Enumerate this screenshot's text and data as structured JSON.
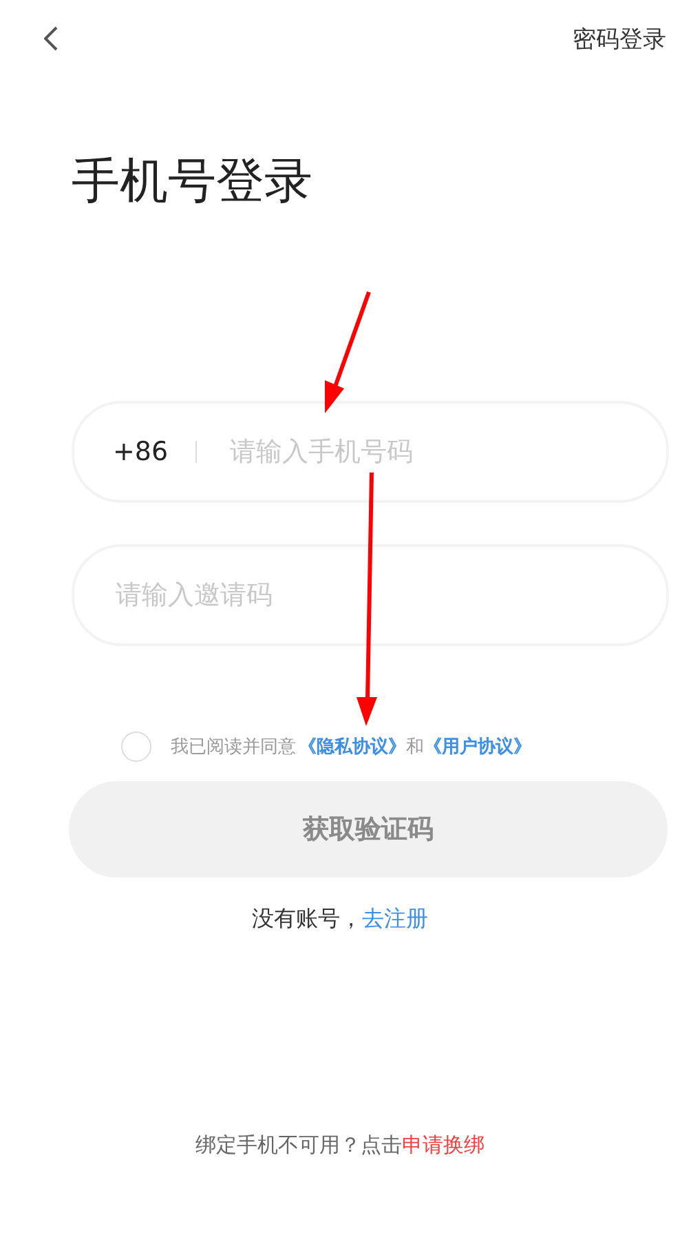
{
  "header": {
    "action": "密码登录"
  },
  "title": "手机号登录",
  "phone_field": {
    "prefix": "+86",
    "placeholder": "请输入手机号码"
  },
  "invite_field": {
    "placeholder": "请输入邀请码"
  },
  "agreement": {
    "checked": false,
    "text": "我已阅读并同意",
    "links": [
      "《隐私协议》",
      "《用户协议》"
    ],
    "joiner": "和"
  },
  "submit": {
    "label": "获取验证码",
    "disabled": true
  },
  "register": {
    "text": "没有账号，",
    "link": "去注册"
  },
  "footer": {
    "text": "绑定手机不可用？点击",
    "link": "申请换绑"
  }
}
